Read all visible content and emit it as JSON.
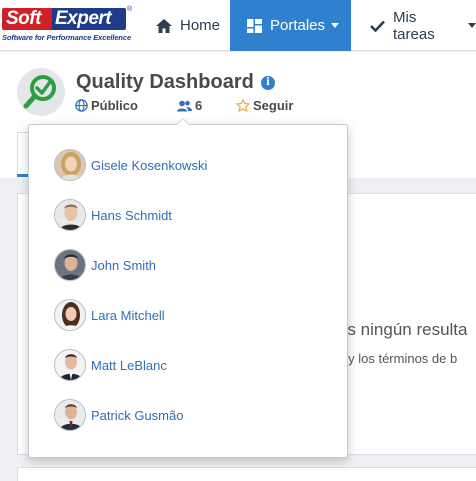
{
  "logo": {
    "soft": "Soft",
    "expert": "Expert",
    "registered": "®",
    "tagline": "Software for Performance Excellence"
  },
  "nav": {
    "home": "Home",
    "portales": "Portales",
    "mis_tareas": "Mis tareas"
  },
  "portal": {
    "title": "Quality Dashboard",
    "visibility": "Público",
    "member_count": "6",
    "follow": "Seguir"
  },
  "content": {
    "no_results": "os ningún resulta",
    "hint": "s y los términos de b"
  },
  "members": [
    {
      "name": "Gisele Kosenkowski"
    },
    {
      "name": "Hans Schmidt"
    },
    {
      "name": "John Smith"
    },
    {
      "name": "Lara Mitchell"
    },
    {
      "name": "Matt LeBlanc"
    },
    {
      "name": "Patrick Gusmão"
    }
  ],
  "colors": {
    "accent": "#2f80cf",
    "link": "#2f6fb5",
    "brand_red": "#d21f26",
    "brand_blue": "#1e3a8a",
    "portal_icon_green": "#2e9e44"
  }
}
